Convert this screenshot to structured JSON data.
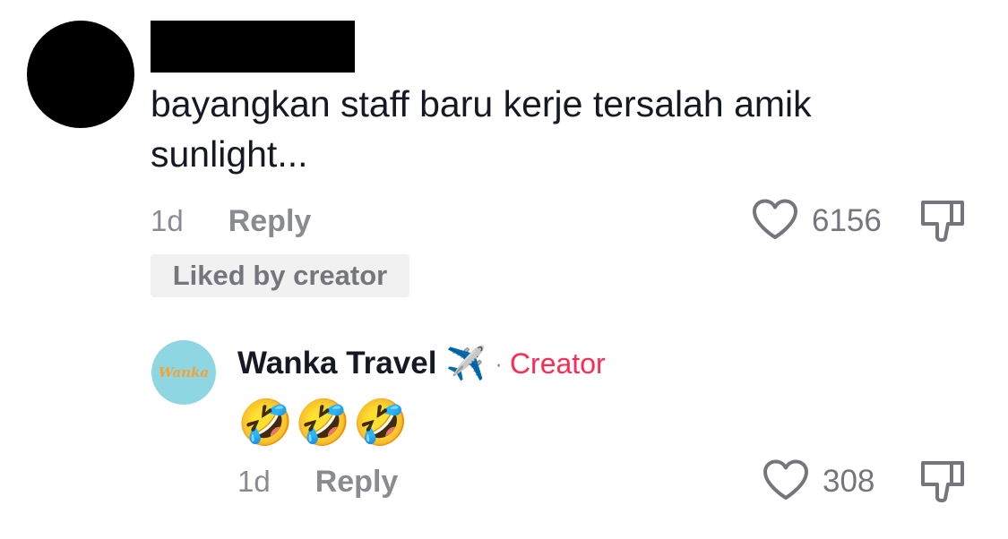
{
  "comment": {
    "text": "bayangkan staff baru kerje tersalah amik sunlight...",
    "time": "1d",
    "reply_label": "Reply",
    "likes": "6156",
    "liked_badge": "Liked by creator"
  },
  "reply": {
    "author": "Wanka Travel",
    "author_emoji": "✈️",
    "separator": "·",
    "creator_label": "Creator",
    "avatar_logo_text": "Wanka",
    "text": "🤣🤣🤣",
    "time": "1d",
    "reply_label": "Reply",
    "likes": "308"
  },
  "colors": {
    "creator": "#fe2c55",
    "meta": "#8a8b91",
    "avatar_reply_bg": "#8fd6e3",
    "badge_bg": "#f1f1f2"
  },
  "icons": {
    "like": "heart-outline-icon",
    "dislike": "thumbs-down-outline-icon"
  }
}
